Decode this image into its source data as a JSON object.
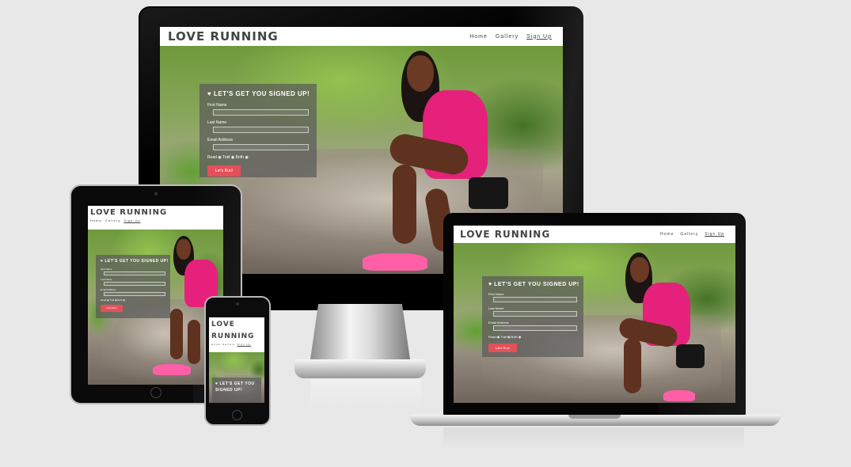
{
  "site": {
    "logo": "LOVE RUNNING",
    "logo_line1": "LOVE",
    "logo_line2": "RUNNING",
    "nav": [
      "Home",
      "Gallery",
      "Sign Up"
    ],
    "heart": "♥"
  },
  "form": {
    "title": "LET'S GET YOU SIGNED UP!",
    "first_name": "First Name",
    "last_name": "Last Name",
    "email": "Email Address",
    "options": "Road ◉ Trail ◉ Both ◉",
    "submit": "Let's Run!"
  },
  "colors": {
    "background": "#e8e8e8",
    "accent": "#e4505a",
    "shirt": "#e5217b"
  }
}
